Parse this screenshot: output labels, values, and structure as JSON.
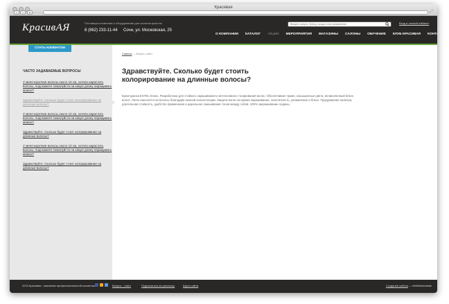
{
  "browser": {
    "title": "Красивая"
  },
  "header": {
    "logo": "КрасивАЯ",
    "tagline": "Поставщик косметики и оборудования для салонов красоты",
    "phone": "8 (862) 233-11-44",
    "address": "Сочи, ул. Московская, 25",
    "search_placeholder": "Введите запрос: бренд, продукт или направление",
    "login": "Вход в личный кабинет"
  },
  "nav": [
    {
      "label": "О КОМПАНИИ",
      "muted": false
    },
    {
      "label": "КАТАЛОГ",
      "muted": false
    },
    {
      "label": "АКЦИИ",
      "muted": true
    },
    {
      "label": "МЕРОПРИЯТИЯ",
      "muted": false
    },
    {
      "label": "МАГАЗИНЫ",
      "muted": false
    },
    {
      "label": "САЛОНЫ",
      "muted": false
    },
    {
      "label": "ОБУЧЕНИЕ",
      "muted": false
    },
    {
      "label": "КЛУБ КРАСИВАЯ",
      "muted": false
    },
    {
      "label": "КОНТАКТЫ",
      "muted": false
    }
  ],
  "sidebar": {
    "client_button": "СТАТЬ КЛИЕНТОМ",
    "faq_title": "ЧАСТО ЗАДАВАЕМЫЕ ВОПРОСЫ",
    "faq": [
      {
        "text": "У меня короткие волосы около 10 см, хотела нарастить волосы, подскажите пожалуйста на какую длину наращивать можно?",
        "active": false
      },
      {
        "text": "Здравствуйте. Сколько будет стоит колорирование на длинные волосы?",
        "active": true
      },
      {
        "text": "У меня короткие волосы около 10 см, хотела нарастить волосы, подскажите пожалуйста на какую длину наращивать можно?",
        "active": false
      },
      {
        "text": "Здравствуйте. Сколько будет стоит колорирование на длинные волосы?",
        "active": false
      },
      {
        "text": "У меня короткие волосы около 10 см, хотела нарастить волосы, подскажите пожалуйста на какую длину наращивать можно?",
        "active": false
      },
      {
        "text": "Здравствуйте. Сколько будет стоит колорирование на длинные волосы?",
        "active": false
      }
    ]
  },
  "content": {
    "breadcrumb_home": "Главная",
    "breadcrumb_sep": " — ",
    "breadcrumb_current": "Вопрос-ответ",
    "heading": "Здравствуйте. Сколько будет стоить колорирование на длинные волосы?",
    "answer": "Крем-краска ESTEL Essex. Разработана для стойкого окрашивания и интенсивного тонирования волос. Обеспечивает яркие, насыщенные цвета, великолепный блеск волос. Легко наносится на волосы благодаря нежной консистенции. Защита волос во время окрашивания, эластичность, увлажнение и блеск. Продуманная палитра, длительная стойкость, удобство применения и идеальное смешивание тонов между собой. 100% закрашивание седины."
  },
  "footer": {
    "copyright": "2013 Красивая - магазины профессиональной косметики",
    "links": [
      "Вопрос - ответ",
      "Подписаться на рассылку",
      "Карта сайта"
    ],
    "credit_prefix": "Создание сайтов",
    "credit_sep": " — ",
    "credit_name": "WebMarmalade",
    "colors": {
      "social1": "#3b5998",
      "social2": "#f5a623",
      "social3": "#5b9bd5"
    }
  }
}
